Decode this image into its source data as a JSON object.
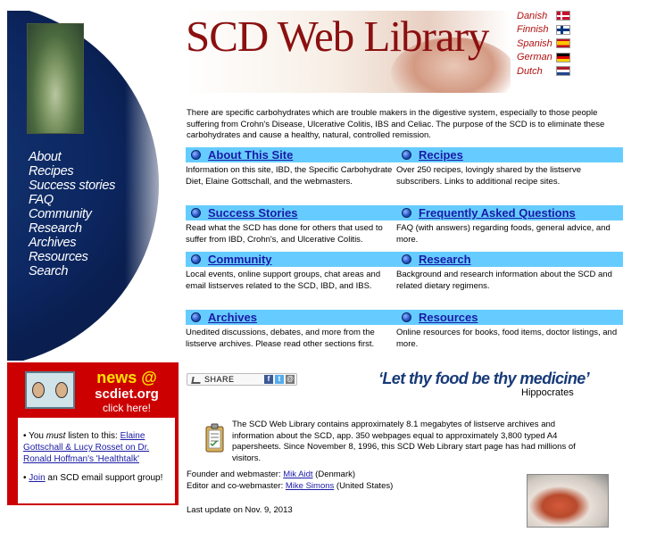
{
  "header": {
    "title": "SCD Web Library",
    "languages": [
      {
        "label": "Danish",
        "flag": "danish-flag-icon"
      },
      {
        "label": "Finnish",
        "flag": "finnish-flag-icon"
      },
      {
        "label": "Spanish",
        "flag": "spanish-flag-icon"
      },
      {
        "label": "German",
        "flag": "german-flag-icon"
      },
      {
        "label": "Dutch",
        "flag": "dutch-flag-icon"
      }
    ]
  },
  "nav": {
    "items": [
      "About",
      "Recipes",
      "Success stories",
      "FAQ",
      "Community",
      "Research",
      "Archives",
      "Resources",
      "Search"
    ]
  },
  "intro": "There are specific carbohydrates which are trouble makers in the digestive system, especially to those people suffering from Crohn's Disease, Ulcerative Colitis, IBS and Celiac. The purpose of the SCD is to eliminate these carbohydrates and cause a healthy, natural, controlled remission.",
  "sections": [
    {
      "title": "About This Site",
      "text": "Information on this site, IBD, the Specific Carbohydrate Diet, Elaine Gottschall, and the webmasters."
    },
    {
      "title": "Recipes",
      "text": "Over 250 recipes, lovingly shared by the listserve subscribers. Links to additional recipe sites."
    },
    {
      "title": "Success Stories",
      "text": "Read what the SCD has done for others that used to suffer from IBD, Crohn's, and Ulcerative Colitis."
    },
    {
      "title": "Frequently Asked Questions",
      "text": "FAQ (with answers) regarding foods, general advice, and more."
    },
    {
      "title": "Community",
      "text": "Local events, online support groups, chat areas and email listserves related to the SCD, IBD, and IBS."
    },
    {
      "title": "Research",
      "text": "Background and research information about the SCD and related dietary regimens."
    },
    {
      "title": "Archives",
      "text": "Unedited discussions, debates, and more from the listserve archives. Please read other sections first."
    },
    {
      "title": "Resources",
      "text": "Online resources for books, food items, doctor listings, and more."
    }
  ],
  "news": {
    "title": "news @",
    "site": "scdiet.org",
    "click": "click here!",
    "item1_prefix": "• You ",
    "item1_em": "must",
    "item1_mid": " listen to this: ",
    "item1_link": "Elaine Gottschall & Lucy Rosset on Dr. Ronald Hoffman's 'Healthtalk'",
    "item2_prefix": "• ",
    "item2_link": "Join",
    "item2_suffix": " an SCD email support group!"
  },
  "share": {
    "label": "SHARE"
  },
  "quote": {
    "text": "‘Let thy food be thy medicine’",
    "author": "Hippocrates"
  },
  "about": "The SCD Web Library contains approximately 8.1 megabytes of listserve archives and information about the SCD, app. 350 webpages equal to approximately 3,800 typed A4 papersheets. Since November 8, 1996, this SCD Web Library start page has had millions of visitors.",
  "credits": {
    "founder_label": "Founder and webmaster: ",
    "founder_name": "Mik Aidt",
    "founder_country": " (Denmark)",
    "editor_label": "Editor and co-webmaster: ",
    "editor_name": "Mike Simons",
    "editor_country": " (United States)",
    "updated": "Last update on Nov. 9, 2013"
  },
  "colors": {
    "bar": "#66ccff",
    "news_bg": "#cc0000",
    "title": "#8b1010",
    "nav_bg": "#0c2660",
    "link": "#1a1aa6"
  }
}
